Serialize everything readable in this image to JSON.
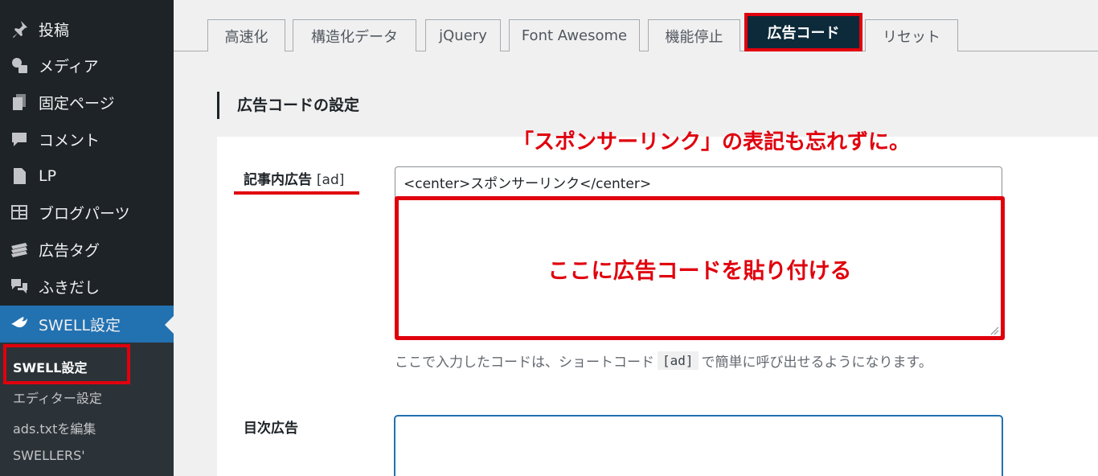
{
  "sidebar": {
    "items": [
      {
        "label": "投稿",
        "icon": "pushpin-icon"
      },
      {
        "label": "メディア",
        "icon": "media-icon"
      },
      {
        "label": "固定ページ",
        "icon": "pages-icon"
      },
      {
        "label": "コメント",
        "icon": "comment-icon"
      },
      {
        "label": "LP",
        "icon": "document-icon"
      },
      {
        "label": "ブログパーツ",
        "icon": "layout-icon"
      },
      {
        "label": "広告タグ",
        "icon": "tag-icon"
      },
      {
        "label": "ふきだし",
        "icon": "bubbles-icon"
      },
      {
        "label": "SWELL設定",
        "icon": "swell-icon"
      }
    ],
    "submenu": [
      "SWELL設定",
      "エディター設定",
      "ads.txtを編集",
      "SWELLERS'"
    ]
  },
  "tabs": [
    "高速化",
    "構造化データ",
    "jQuery",
    "Font Awesome",
    "機能停止",
    "広告コード",
    "リセット"
  ],
  "section": {
    "title": "広告コードの設定",
    "annotation": "「スポンサーリンク」の表記も忘れずに。"
  },
  "field1": {
    "label": "記事内広告",
    "code": "[ad]",
    "value": "<center>スポンサーリンク</center>",
    "paste_note": "ここに広告コードを貼り付ける",
    "help_before": "ここで入力したコードは、ショートコード",
    "help_code": "[ad]",
    "help_after": "で簡単に呼び出せるようになります。"
  },
  "field2": {
    "label": "目次広告"
  },
  "colors": {
    "sidebar_bg": "#1d2327",
    "accent": "#2271b1",
    "annotation": "#e0000d"
  }
}
